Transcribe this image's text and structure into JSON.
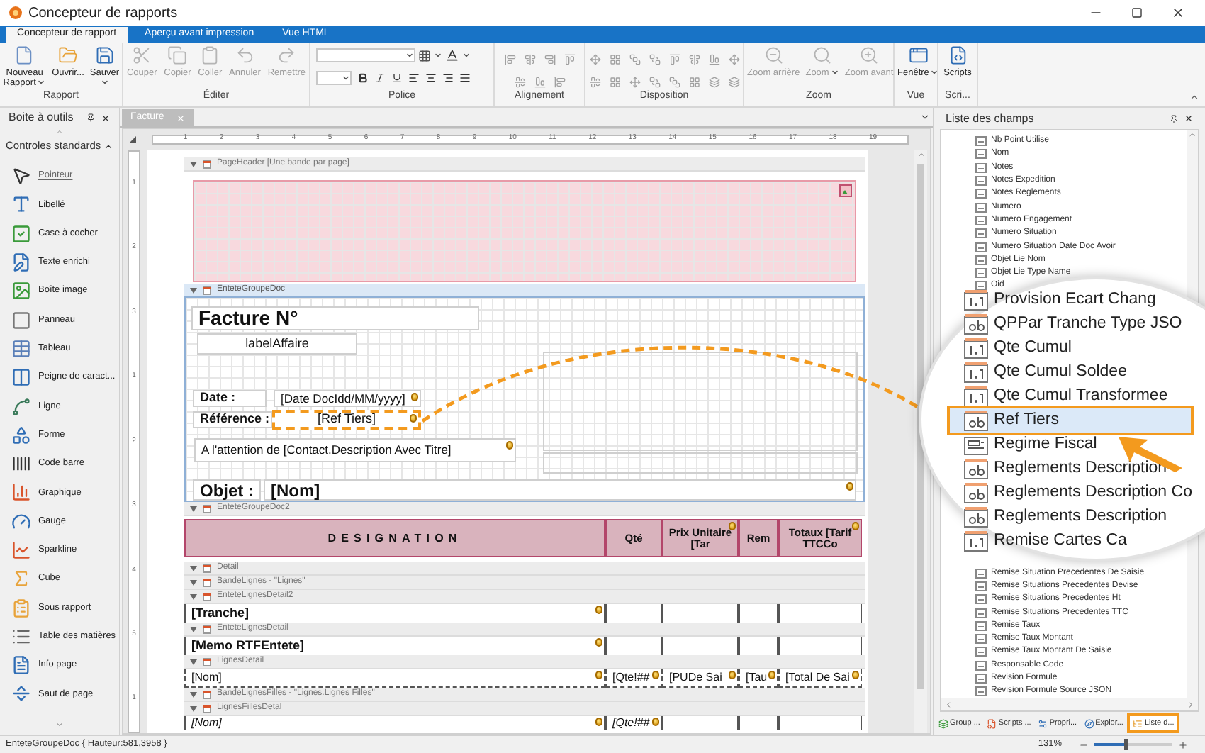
{
  "window": {
    "title": "Concepteur de rapports"
  },
  "ribbon_tabs": [
    {
      "label": "Concepteur de rapport",
      "selected": true
    },
    {
      "label": "Aperçu avant impression",
      "selected": false
    },
    {
      "label": "Vue HTML",
      "selected": false
    }
  ],
  "ribbon_groups": [
    {
      "label": "Rapport",
      "kind": "buttons",
      "buttons": [
        {
          "label": "Nouveau Rapport",
          "disabled": false,
          "dropdown": true
        },
        {
          "label": "Ouvrir...",
          "disabled": false,
          "dropdown": false
        },
        {
          "label": "Sauver",
          "disabled": false,
          "dropdown": true
        }
      ]
    },
    {
      "label": "Éditer",
      "kind": "buttons",
      "buttons": [
        {
          "label": "Couper",
          "disabled": true,
          "dropdown": false
        },
        {
          "label": "Copier",
          "disabled": true,
          "dropdown": false
        },
        {
          "label": "Coller",
          "disabled": true,
          "dropdown": false
        },
        {
          "label": "Annuler",
          "disabled": true,
          "dropdown": false
        },
        {
          "label": "Remettre",
          "disabled": true,
          "dropdown": false
        }
      ]
    },
    {
      "label": "Police",
      "kind": "font"
    },
    {
      "label": "Alignement",
      "kind": "alignment"
    },
    {
      "label": "Disposition",
      "kind": "layout"
    },
    {
      "label": "Zoom",
      "kind": "buttons",
      "buttons": [
        {
          "label": "Zoom arrière",
          "disabled": true,
          "dropdown": false
        },
        {
          "label": "Zoom",
          "disabled": true,
          "dropdown": true
        },
        {
          "label": "Zoom avant",
          "disabled": true,
          "dropdown": false
        }
      ]
    },
    {
      "label": "Vue",
      "kind": "buttons",
      "buttons": [
        {
          "label": "Fenêtre",
          "disabled": false,
          "dropdown": true
        }
      ]
    },
    {
      "label": "Scri...",
      "kind": "buttons",
      "buttons": [
        {
          "label": "Scripts",
          "disabled": false,
          "dropdown": false
        }
      ]
    }
  ],
  "toolbox": {
    "title": "Boite à outils",
    "section": {
      "label": "Controles standards",
      "expanded": true
    },
    "items": [
      {
        "label": "Pointeur",
        "selected": true
      },
      {
        "label": "Libellé",
        "selected": false
      },
      {
        "label": "Case à cocher",
        "selected": false
      },
      {
        "label": "Texte enrichi",
        "selected": false
      },
      {
        "label": "Boîte image",
        "selected": false
      },
      {
        "label": "Panneau",
        "selected": false
      },
      {
        "label": "Tableau",
        "selected": false
      },
      {
        "label": "Peigne de caract...",
        "selected": false
      },
      {
        "label": "Ligne",
        "selected": false
      },
      {
        "label": "Forme",
        "selected": false
      },
      {
        "label": "Code barre",
        "selected": false
      },
      {
        "label": "Graphique",
        "selected": false
      },
      {
        "label": "Gauge",
        "selected": false
      },
      {
        "label": "Sparkline",
        "selected": false
      },
      {
        "label": "Cube",
        "selected": false
      },
      {
        "label": "Sous rapport",
        "selected": false
      },
      {
        "label": "Table des matières",
        "selected": false
      },
      {
        "label": "Info page",
        "selected": false
      },
      {
        "label": "Saut de page",
        "selected": false
      }
    ]
  },
  "designer": {
    "tab": {
      "label": "Facture"
    },
    "ruler": [
      "1",
      "2",
      "3",
      "4",
      "5",
      "6",
      "7",
      "8",
      "9",
      "10",
      "11",
      "12",
      "13",
      "14",
      "15",
      "16",
      "17",
      "18",
      "19"
    ],
    "vertical_ruler": [
      "1",
      "2",
      "3",
      "1",
      "2",
      "3",
      "4",
      "5",
      "1"
    ],
    "bands": [
      {
        "kind": "header",
        "label": "PageHeader [Une bande par page]",
        "selected": false
      },
      {
        "kind": "area"
      },
      {
        "kind": "header",
        "label": "EnteteGroupeDoc",
        "selected": true
      },
      {
        "kind": "form",
        "fields": [
          {
            "text": "Facture N°",
            "kind": "title",
            "marker": false,
            "selected": false
          },
          {
            "text": "labelAffaire",
            "kind": "plain",
            "marker": false,
            "selected": false
          },
          {
            "text": "Date :",
            "kind": "caption",
            "marker": false,
            "selected": false
          },
          {
            "text": "[Date DocIdd/MM/yyyy]",
            "kind": "value",
            "marker": true,
            "selected": false
          },
          {
            "text": "Référence :",
            "kind": "caption",
            "marker": false,
            "selected": false
          },
          {
            "text": "[Ref Tiers]",
            "kind": "plain",
            "marker": true,
            "selected": true
          },
          {
            "text": "A l'attention de [Contact.Description Avec Titre]",
            "kind": "value",
            "marker": true,
            "selected": false
          },
          {
            "text": "Objet :",
            "kind": "big",
            "marker": false,
            "selected": false
          },
          {
            "text": "[Nom]",
            "kind": "big",
            "marker": true,
            "selected": false
          }
        ]
      },
      {
        "kind": "header",
        "label": "EnteteGroupeDoc2",
        "selected": false
      },
      {
        "kind": "table_header",
        "cells": [
          {
            "text": "DESIGNATION",
            "marker": false
          },
          {
            "text": "Qté",
            "marker": false
          },
          {
            "text": "Prix Unitaire [Tar",
            "marker": true
          },
          {
            "text": "Rem",
            "marker": false
          },
          {
            "text": "Totaux [Tarif TTCCo",
            "marker": true
          }
        ]
      },
      {
        "kind": "header",
        "label": "Detail",
        "selected": false
      },
      {
        "kind": "header",
        "label": "BandeLignes - \"Lignes\"",
        "selected": false
      },
      {
        "kind": "header",
        "label": "EnteteLignesDetail2",
        "selected": false
      },
      {
        "kind": "bold_row",
        "cells": [
          "[Tranche]"
        ]
      },
      {
        "kind": "header",
        "label": "EnteteLignesDetail",
        "selected": false
      },
      {
        "kind": "bold_row",
        "cells": [
          "[Memo RTFEntete]"
        ]
      },
      {
        "kind": "header",
        "label": "LignesDetail",
        "selected": false
      },
      {
        "kind": "plain_row",
        "cells": [
          "[Nom]",
          "[Qte!##",
          "[PUDe Sai",
          "[Tau",
          "[Total De Sai"
        ]
      },
      {
        "kind": "header",
        "label": "BandeLignesFilles - \"Lignes.Lignes Filles\"",
        "selected": false
      },
      {
        "kind": "header",
        "label": "LignesFillesDetal",
        "selected": false
      },
      {
        "kind": "italic_row",
        "cells": [
          "[Nom]",
          "[Qte!##"
        ]
      }
    ]
  },
  "field_list": {
    "title": "Liste des champs",
    "items_top": [
      "Nb Point Utilise",
      "Nom",
      "Notes",
      "Notes Expedition",
      "Notes Reglements",
      "Numero",
      "Numero Engagement",
      "Numero Situation",
      "Numero Situation Date Doc Avoir",
      "Objet Lie Nom",
      "Objet Lie Type Name",
      "Oid"
    ],
    "items_bottom": [
      "Remise Situation Precedentes De Saisie",
      "Remise Situations Precedentes Devise",
      "Remise Situations Precedentes Ht",
      "Remise Situations Precedentes TTC",
      "Remise Taux",
      "Remise Taux Montant",
      "Remise Taux Montant De Saisie",
      "Responsable Code",
      "Revision Formule",
      "Revision Formule Source JSON"
    ],
    "magnifier": [
      {
        "label": "Provision Ecart Chang",
        "kind": "number",
        "selected": false
      },
      {
        "label": "QPPar Tranche Type JSO",
        "kind": "text",
        "selected": false
      },
      {
        "label": "Qte Cumul",
        "kind": "number",
        "selected": false
      },
      {
        "label": "Qte Cumul Soldee",
        "kind": "number",
        "selected": false
      },
      {
        "label": "Qte Cumul Transformee",
        "kind": "number",
        "selected": false
      },
      {
        "label": "Ref Tiers",
        "kind": "text",
        "selected": true
      },
      {
        "label": "Regime Fiscal",
        "kind": "list",
        "selected": false
      },
      {
        "label": "Reglements Description",
        "kind": "text",
        "selected": false
      },
      {
        "label": "Reglements Description Co",
        "kind": "text",
        "selected": false
      },
      {
        "label": "Reglements Description",
        "kind": "text",
        "selected": false
      },
      {
        "label": "Remise Cartes Ca",
        "kind": "number",
        "selected": false
      }
    ]
  },
  "bottom_tabs": [
    {
      "label": "Group ...",
      "selected": false
    },
    {
      "label": "Scripts ...",
      "selected": false
    },
    {
      "label": "Propri...",
      "selected": false
    },
    {
      "label": "Explor...",
      "selected": false
    },
    {
      "label": "Liste d...",
      "selected": true
    }
  ],
  "status_bar": {
    "text": "EnteteGroupeDoc { Hauteur:581,3958 }",
    "zoom": "131%",
    "slider": {
      "level": 0.4
    }
  }
}
